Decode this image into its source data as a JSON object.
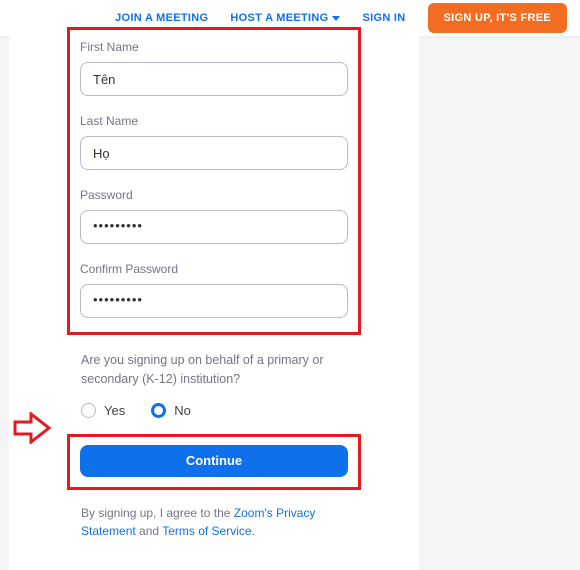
{
  "nav": {
    "join": "JOIN A MEETING",
    "host": "HOST A MEETING",
    "signin": "SIGN IN",
    "signup": "SIGN UP, IT'S FREE"
  },
  "form": {
    "first_name_label": "First Name",
    "first_name_value": "Tên",
    "last_name_label": "Last Name",
    "last_name_value": "Họ",
    "password_label": "Password",
    "password_value": "•••••••••",
    "confirm_label": "Confirm Password",
    "confirm_value": "•••••••••"
  },
  "k12": {
    "question": "Are you signing up on behalf of a primary or secondary (K-12) institution?",
    "yes": "Yes",
    "no": "No",
    "selected": "no"
  },
  "continue_label": "Continue",
  "legal": {
    "prefix": "By signing up, I agree to the ",
    "privacy": "Zoom's Privacy Statement",
    "joiner": " and ",
    "tos": "Terms of Service",
    "suffix": "."
  }
}
